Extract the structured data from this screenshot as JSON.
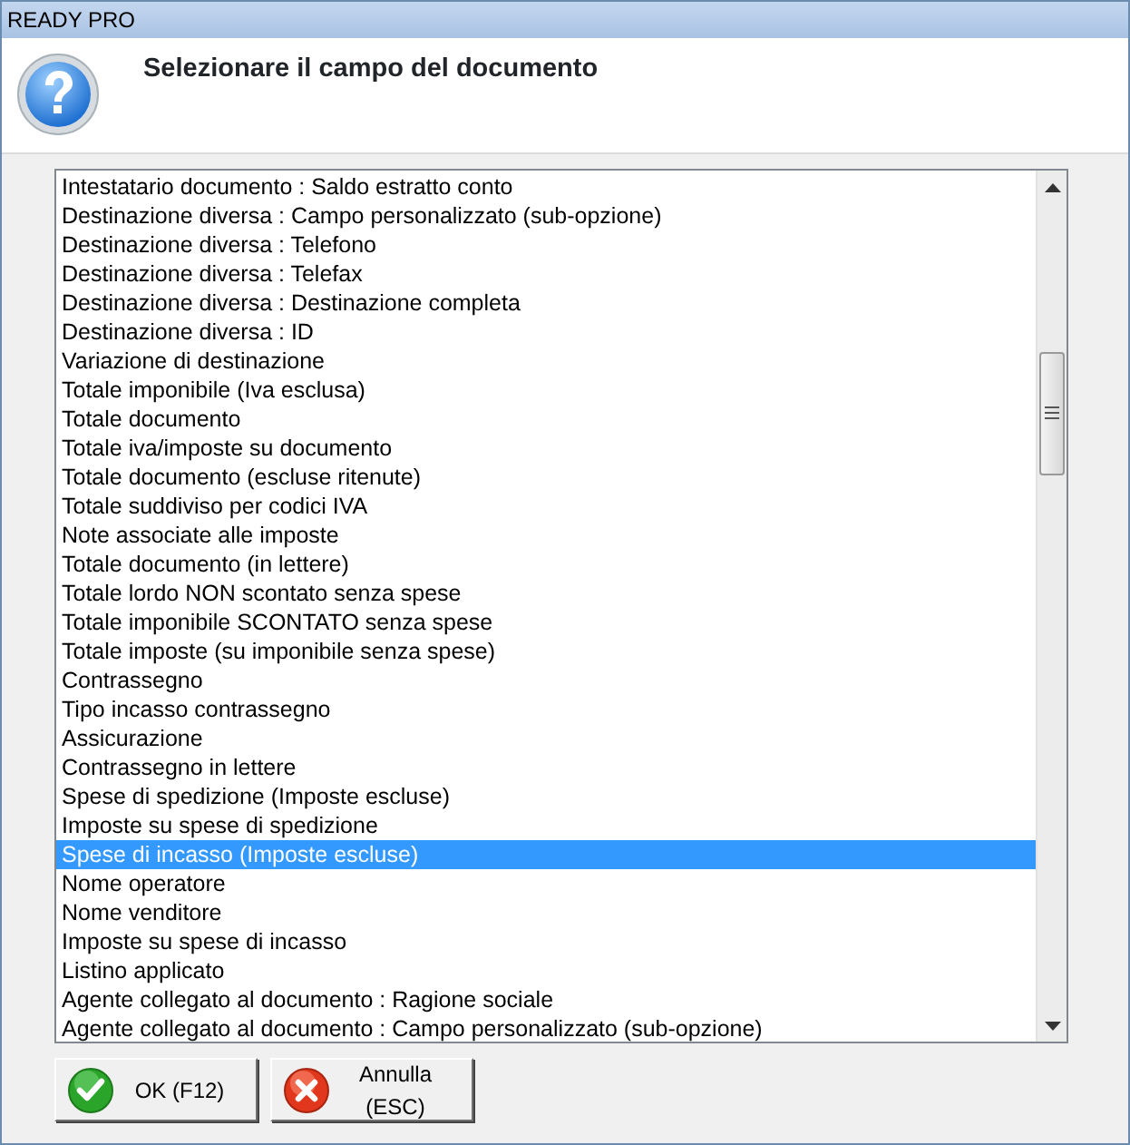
{
  "window": {
    "title": "READY PRO"
  },
  "header": {
    "title": "Selezionare il campo del documento"
  },
  "list": {
    "items": [
      {
        "label": "Intestatario documento : Saldo estratto conto",
        "selected": false
      },
      {
        "label": "Destinazione diversa : Campo personalizzato (sub-opzione)",
        "selected": false
      },
      {
        "label": "Destinazione diversa : Telefono",
        "selected": false
      },
      {
        "label": "Destinazione diversa : Telefax",
        "selected": false
      },
      {
        "label": "Destinazione diversa : Destinazione completa",
        "selected": false
      },
      {
        "label": "Destinazione diversa : ID",
        "selected": false
      },
      {
        "label": "Variazione di destinazione",
        "selected": false
      },
      {
        "label": "Totale imponibile (Iva esclusa)",
        "selected": false
      },
      {
        "label": "Totale documento",
        "selected": false
      },
      {
        "label": "Totale iva/imposte su documento",
        "selected": false
      },
      {
        "label": "Totale documento (escluse ritenute)",
        "selected": false
      },
      {
        "label": "Totale suddiviso per codici IVA",
        "selected": false
      },
      {
        "label": "Note associate alle imposte",
        "selected": false
      },
      {
        "label": "Totale documento (in lettere)",
        "selected": false
      },
      {
        "label": "Totale lordo NON scontato senza spese",
        "selected": false
      },
      {
        "label": "Totale imponibile SCONTATO senza spese",
        "selected": false
      },
      {
        "label": "Totale imposte (su imponibile senza spese)",
        "selected": false
      },
      {
        "label": "Contrassegno",
        "selected": false
      },
      {
        "label": "Tipo incasso contrassegno",
        "selected": false
      },
      {
        "label": "Assicurazione",
        "selected": false
      },
      {
        "label": "Contrassegno in lettere",
        "selected": false
      },
      {
        "label": "Spese di spedizione (Imposte escluse)",
        "selected": false
      },
      {
        "label": "Imposte su spese di spedizione",
        "selected": false
      },
      {
        "label": "Spese di incasso (Imposte escluse)",
        "selected": true
      },
      {
        "label": "Nome operatore",
        "selected": false
      },
      {
        "label": "Nome venditore",
        "selected": false
      },
      {
        "label": "Imposte su spese di incasso",
        "selected": false
      },
      {
        "label": "Listino applicato",
        "selected": false
      },
      {
        "label": "Agente collegato al documento : Ragione sociale",
        "selected": false
      },
      {
        "label": "Agente collegato al documento : Campo personalizzato (sub-opzione)",
        "selected": false
      }
    ]
  },
  "buttons": [
    {
      "label": "OK (F12)",
      "kind": "ok"
    },
    {
      "label": "Annulla (ESC)",
      "kind": "cancel"
    }
  ]
}
